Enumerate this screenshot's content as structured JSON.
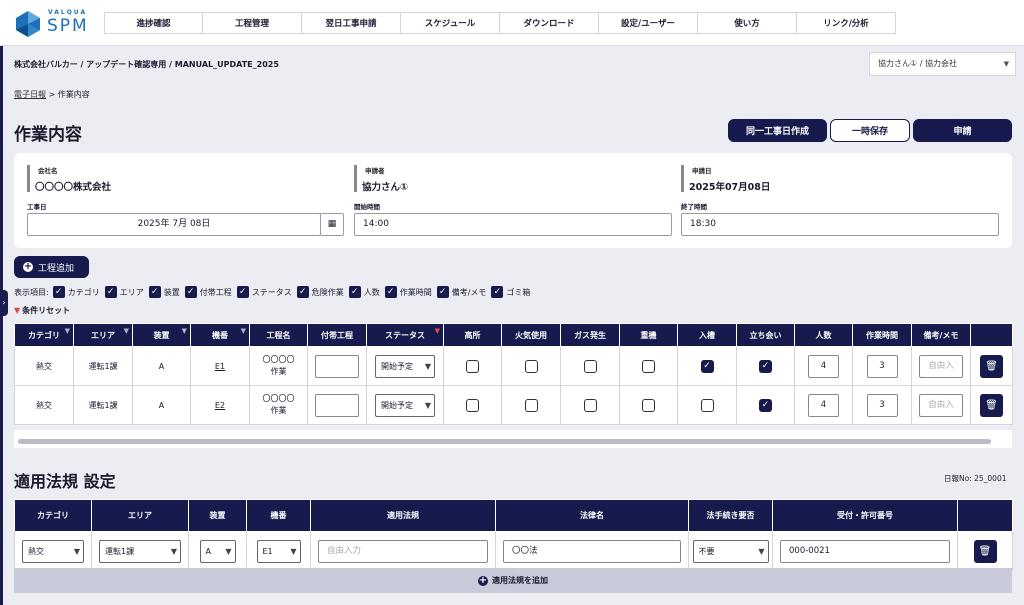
{
  "logo": {
    "top": "VALQUA",
    "main": "SPM"
  },
  "nav": [
    "進捗確認",
    "工程管理",
    "翌日工事申請",
    "スケジュール",
    "ダウンロード",
    "設定/ユーザー",
    "使い方",
    "リンク/分析"
  ],
  "company_path": "株式会社バルカー / アップデート確認専用 / MANUAL_UPDATE_2025",
  "user_select": "協力さん① / 協力会社",
  "breadcrumb": {
    "link": "電子日報",
    "sep": ">",
    "current": "作業内容"
  },
  "page_title": "作業内容",
  "buttons": {
    "same_day": "同一工事日作成",
    "temp_save": "一時保存",
    "apply": "申請"
  },
  "info": {
    "company_label": "会社名",
    "company_value": "〇〇〇〇株式会社",
    "applicant_label": "申請者",
    "applicant_value": "協力さん①",
    "date_label": "申請日",
    "date_value": "2025年07月08日",
    "work_date_label": "工事日",
    "work_date_value": "2025年 7月 08日",
    "start_label": "開始時間",
    "start_value": "14:00",
    "end_label": "終了時間",
    "end_value": "18:30"
  },
  "add_process": "工程追加",
  "display": {
    "label": "表示項目:",
    "items": [
      "カテゴリ",
      "エリア",
      "装置",
      "付帯工程",
      "ステータス",
      "危険作業",
      "人数",
      "作業時間",
      "備考/メモ",
      "ゴミ箱"
    ]
  },
  "reset": "条件リセット",
  "table1": {
    "headers": [
      "カテゴリ",
      "エリア",
      "装置",
      "機番",
      "工程名",
      "付帯工程",
      "ステータス",
      "高所",
      "火気使用",
      "ガス発生",
      "重機",
      "入槽",
      "立ち会い",
      "人数",
      "作業時間",
      "備考/メモ"
    ],
    "status_placeholder": "開始予定",
    "memo_placeholder": "自由入",
    "rows": [
      {
        "category": "熱交",
        "area": "運転1課",
        "device": "A",
        "unit": "E1",
        "process": "〇〇〇〇作業",
        "checks": [
          false,
          false,
          false,
          false,
          true,
          true
        ],
        "people": "4",
        "hours": "3"
      },
      {
        "category": "熱交",
        "area": "運転1課",
        "device": "A",
        "unit": "E2",
        "process": "〇〇〇〇作業",
        "checks": [
          false,
          false,
          false,
          false,
          false,
          true
        ],
        "people": "4",
        "hours": "3"
      }
    ]
  },
  "section2_title": "適用法規 設定",
  "nippo_no": "日報No: 25_0001",
  "table2": {
    "headers": [
      "カテゴリ",
      "エリア",
      "装置",
      "機番",
      "適用法規",
      "法律名",
      "法手続き要否",
      "受付・許可番号"
    ],
    "row": {
      "category": "熱交",
      "area": "運転1課",
      "device": "A",
      "unit": "E1",
      "law_placeholder": "自由入力",
      "law_name": "〇〇法",
      "need": "不要",
      "permit": "000-0021"
    }
  },
  "add_rule": "適用法規を追加",
  "colors": {
    "navy": "#161a4c",
    "logo_blue": "#1d6fb8"
  }
}
